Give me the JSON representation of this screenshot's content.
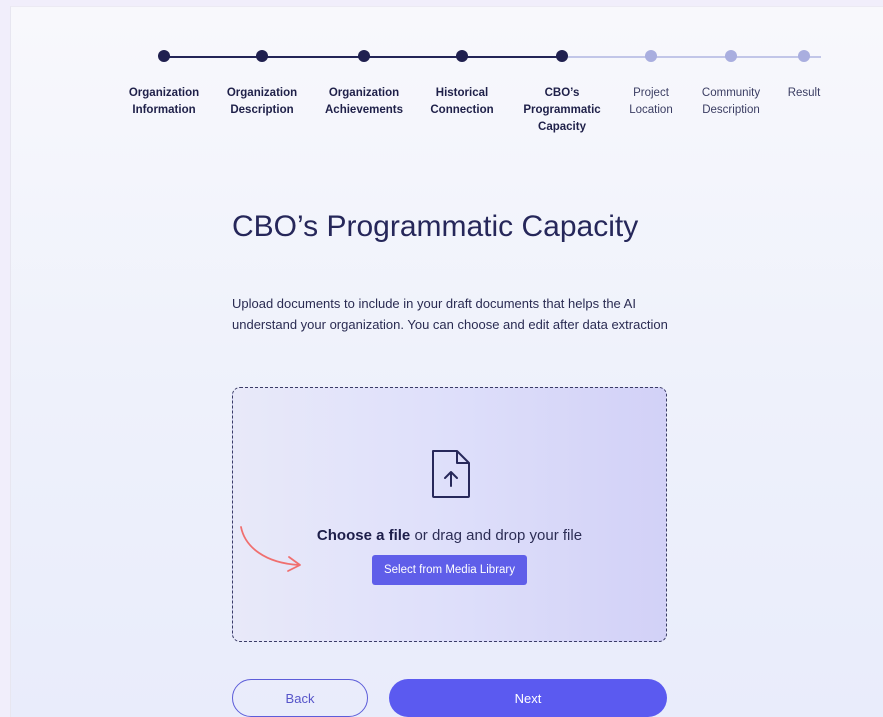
{
  "steps": [
    {
      "label": "Organization Information",
      "state": "done"
    },
    {
      "label": "Organization Description",
      "state": "done"
    },
    {
      "label": "Organization Achievements",
      "state": "done"
    },
    {
      "label": "Historical Connection",
      "state": "done"
    },
    {
      "label": "CBO’s Programmatic Capacity",
      "state": "current"
    },
    {
      "label": "Project Location",
      "state": "pending"
    },
    {
      "label": "Community Description",
      "state": "pending"
    },
    {
      "label": "Result",
      "state": "pending"
    }
  ],
  "page": {
    "title": "CBO’s Programmatic Capacity",
    "description": "Upload documents to include in your draft documents that helps the AI understand your organization. You can choose and edit after data extraction"
  },
  "upload": {
    "choose_label": "Choose a file",
    "drag_text": " or drag and drop your file",
    "media_button": "Select from Media Library"
  },
  "actions": {
    "back": "Back",
    "next": "Next"
  },
  "colors": {
    "primary": "#5b5af0",
    "step_done": "#20204f",
    "step_pending": "#a9aedf",
    "arrow": "#f06f6f"
  }
}
